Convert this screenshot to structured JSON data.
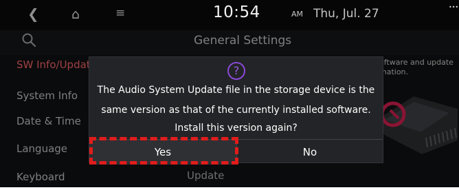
{
  "status_bar": {
    "back_icon": "chevron-left-icon",
    "home_icon": "home-icon",
    "menu_icon": "menu-icon",
    "time": "10:54",
    "ampm": "AM",
    "date": "Thu, Jul. 27",
    "corner_text": "•••"
  },
  "header": {
    "search_icon": "search-icon",
    "title": "General Settings"
  },
  "sidebar": {
    "items": [
      {
        "label": "SW Info/Update",
        "active": true
      },
      {
        "label": "System Info",
        "active": false
      },
      {
        "label": "Date & Time",
        "active": false
      },
      {
        "label": "Language",
        "active": false
      },
      {
        "label": "Keyboard",
        "active": false
      }
    ]
  },
  "content": {
    "description_line1": "oftware and update",
    "description_line2": "mation.",
    "update_label": "Update"
  },
  "dialog": {
    "icon": "question-icon",
    "icon_glyph": "?",
    "line1": "The Audio System Update file in the storage device is the",
    "line2": "same version as that of the currently installed software.",
    "line3": "Install this version again?",
    "yes_label": "Yes",
    "no_label": "No"
  },
  "colors": {
    "accent_active": "#e55d62",
    "icon_purple": "#8a49d8",
    "highlight_red": "#e01c1c"
  }
}
